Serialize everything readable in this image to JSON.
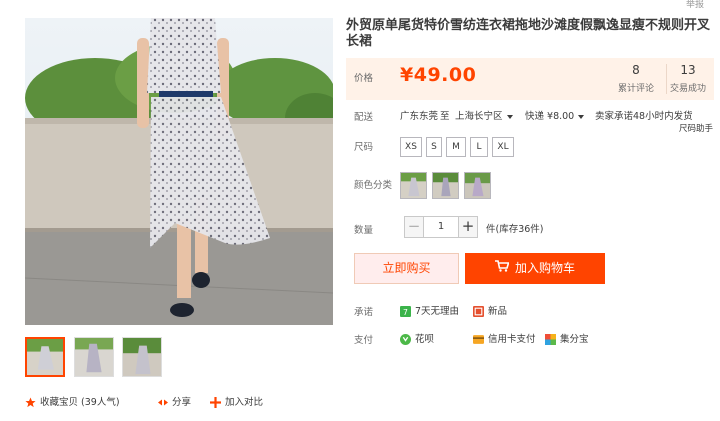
{
  "header": {
    "report_label": "举报"
  },
  "product": {
    "title": "外贸原单尾货特价雪纺连衣裙拖地沙滩度假飘逸显瘦不规则开叉长裙",
    "price_label": "价格",
    "price": "¥49.00",
    "stats": [
      {
        "value": "8",
        "label": "累计评论"
      },
      {
        "value": "13",
        "label": "交易成功"
      }
    ]
  },
  "delivery": {
    "label": "配送",
    "from": "广东东莞",
    "to_word": "至",
    "to": "上海长宁区",
    "shipping": "快递 ¥8.00",
    "promise": "卖家承诺48小时内发货",
    "size_helper": "尺码助手"
  },
  "size": {
    "label": "尺码",
    "options": [
      "XS",
      "S",
      "M",
      "L",
      "XL"
    ]
  },
  "color": {
    "label": "颜色分类",
    "swatch_count_note": "3"
  },
  "quantity": {
    "label": "数量",
    "value": "1",
    "minus": "−",
    "plus": "+",
    "stock": "件(库存36件)"
  },
  "actions": {
    "buy_now": "立即购买",
    "add_to_cart": "加入购物车"
  },
  "promise": {
    "label": "承诺",
    "items": [
      "7天无理由",
      "新品"
    ]
  },
  "payment": {
    "label": "支付",
    "items": [
      "花呗",
      "信用卡支付",
      "集分宝"
    ]
  },
  "bottom": {
    "favorite": "收藏宝贝 (39人气)",
    "share": "分享",
    "compare": "加入对比"
  },
  "colors": {
    "accent": "#ff4400",
    "price_bg": "#fff2e8",
    "buy_bg": "#ffeded"
  }
}
